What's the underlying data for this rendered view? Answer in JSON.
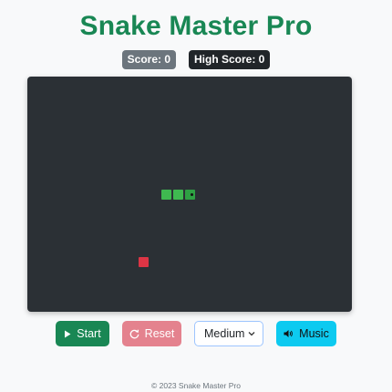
{
  "header": {
    "title": "Snake Master Pro"
  },
  "scoreboard": {
    "score_label": "Score: 0",
    "high_score_label": "High Score: 0"
  },
  "game": {
    "snake_color": "#3fb950",
    "food_color": "#dc3545",
    "board_color": "#2b3035"
  },
  "controls": {
    "start_label": "Start",
    "start_icon": "play-icon",
    "reset_label": "Reset",
    "reset_icon": "reset-icon",
    "difficulty_selected": "Medium",
    "music_label": "Music",
    "music_icon": "speaker-icon"
  },
  "footer": {
    "text": "© 2023 Snake Master Pro"
  }
}
